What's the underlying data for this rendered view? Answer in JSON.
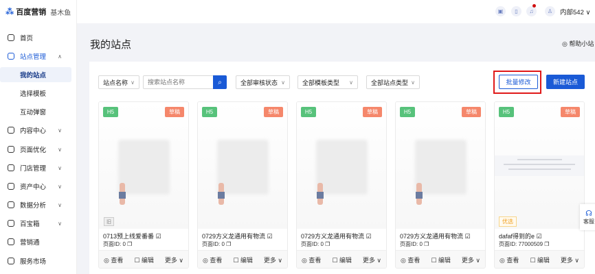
{
  "brand": {
    "name": "百度营销",
    "product": "基木鱼"
  },
  "header": {
    "user": "内部542",
    "icons": [
      "message-icon",
      "clipboard-icon",
      "bell-icon",
      "user-icon"
    ]
  },
  "sidebar": {
    "items": [
      {
        "label": "首页"
      },
      {
        "label": "站点管理"
      },
      {
        "label": "我的站点"
      },
      {
        "label": "选择模板"
      },
      {
        "label": "互动弹窗"
      },
      {
        "label": "内容中心"
      },
      {
        "label": "页面优化"
      },
      {
        "label": "门店管理"
      },
      {
        "label": "资产中心"
      },
      {
        "label": "数据分析"
      },
      {
        "label": "百宝箱"
      },
      {
        "label": "营销通"
      },
      {
        "label": "服务市场"
      }
    ]
  },
  "page": {
    "title": "我的站点",
    "help": "帮助小站"
  },
  "filters": {
    "field": "站点名称",
    "search_placeholder": "搜索站点名称",
    "audit": "全部审核状态",
    "template": "全部模板类型",
    "site": "全部站点类型"
  },
  "actions": {
    "batch": "批量修改",
    "new": "新建站点"
  },
  "cards": [
    {
      "type": "H5",
      "status": "草稿",
      "name": "0713预上线爱番番",
      "id": "页面ID: 0",
      "badge": "旧"
    },
    {
      "type": "H5",
      "status": "草稿",
      "name": "0729方义龙通用有物流",
      "id": "页面ID: 0"
    },
    {
      "type": "H5",
      "status": "草稿",
      "name": "0729方义龙通用有物流",
      "id": "页面ID: 0"
    },
    {
      "type": "H5",
      "status": "草稿",
      "name": "0729方义龙通用有物流",
      "id": "页面ID: 0"
    },
    {
      "type": "H5",
      "status": "草稿",
      "name": "dafaf得到的e",
      "id": "页面ID: 77000509",
      "badge": "优选"
    }
  ],
  "card_actions": {
    "view": "查看",
    "edit": "编辑",
    "more": "更多"
  },
  "float": {
    "label": "客服"
  },
  "colors": {
    "primary": "#1a5ad6",
    "h5": "#57c27b",
    "draft": "#f5876b",
    "highlight": "#e01818"
  }
}
